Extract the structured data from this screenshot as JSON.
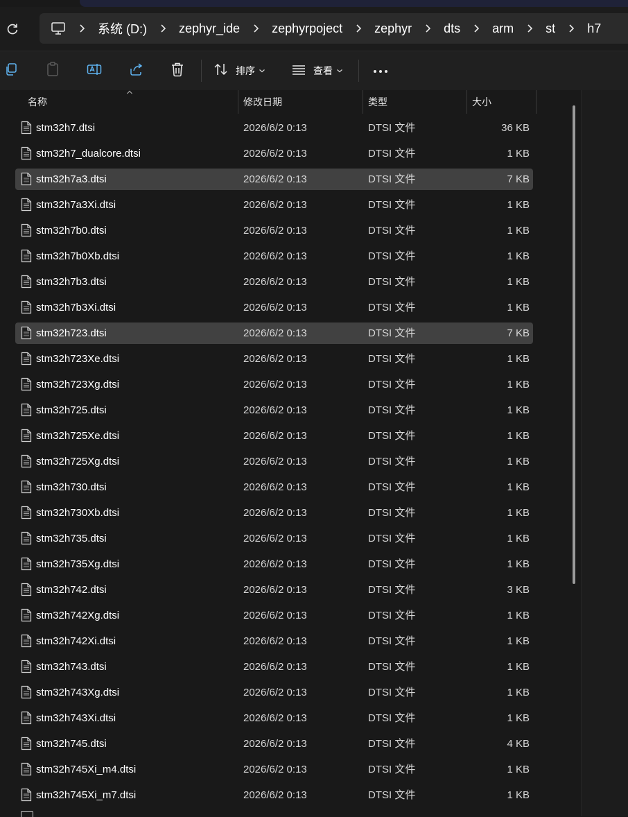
{
  "breadcrumb": [
    "系统 (D:)",
    "zephyr_ide",
    "zephyrpoject",
    "zephyr",
    "dts",
    "arm",
    "st",
    "h7"
  ],
  "toolbar": {
    "sort_label": "排序",
    "view_label": "查看"
  },
  "columns": {
    "name": "名称",
    "modified": "修改日期",
    "type": "类型",
    "size": "大小"
  },
  "files": [
    {
      "name": "stm32h7.dtsi",
      "modified": "2026/6/2 0:13",
      "type": "DTSI 文件",
      "size": "36 KB",
      "selected": false
    },
    {
      "name": "stm32h7_dualcore.dtsi",
      "modified": "2026/6/2 0:13",
      "type": "DTSI 文件",
      "size": "1 KB",
      "selected": false
    },
    {
      "name": "stm32h7a3.dtsi",
      "modified": "2026/6/2 0:13",
      "type": "DTSI 文件",
      "size": "7 KB",
      "selected": true
    },
    {
      "name": "stm32h7a3Xi.dtsi",
      "modified": "2026/6/2 0:13",
      "type": "DTSI 文件",
      "size": "1 KB",
      "selected": false
    },
    {
      "name": "stm32h7b0.dtsi",
      "modified": "2026/6/2 0:13",
      "type": "DTSI 文件",
      "size": "1 KB",
      "selected": false
    },
    {
      "name": "stm32h7b0Xb.dtsi",
      "modified": "2026/6/2 0:13",
      "type": "DTSI 文件",
      "size": "1 KB",
      "selected": false
    },
    {
      "name": "stm32h7b3.dtsi",
      "modified": "2026/6/2 0:13",
      "type": "DTSI 文件",
      "size": "1 KB",
      "selected": false
    },
    {
      "name": "stm32h7b3Xi.dtsi",
      "modified": "2026/6/2 0:13",
      "type": "DTSI 文件",
      "size": "1 KB",
      "selected": false
    },
    {
      "name": "stm32h723.dtsi",
      "modified": "2026/6/2 0:13",
      "type": "DTSI 文件",
      "size": "7 KB",
      "selected": true
    },
    {
      "name": "stm32h723Xe.dtsi",
      "modified": "2026/6/2 0:13",
      "type": "DTSI 文件",
      "size": "1 KB",
      "selected": false
    },
    {
      "name": "stm32h723Xg.dtsi",
      "modified": "2026/6/2 0:13",
      "type": "DTSI 文件",
      "size": "1 KB",
      "selected": false
    },
    {
      "name": "stm32h725.dtsi",
      "modified": "2026/6/2 0:13",
      "type": "DTSI 文件",
      "size": "1 KB",
      "selected": false
    },
    {
      "name": "stm32h725Xe.dtsi",
      "modified": "2026/6/2 0:13",
      "type": "DTSI 文件",
      "size": "1 KB",
      "selected": false
    },
    {
      "name": "stm32h725Xg.dtsi",
      "modified": "2026/6/2 0:13",
      "type": "DTSI 文件",
      "size": "1 KB",
      "selected": false
    },
    {
      "name": "stm32h730.dtsi",
      "modified": "2026/6/2 0:13",
      "type": "DTSI 文件",
      "size": "1 KB",
      "selected": false
    },
    {
      "name": "stm32h730Xb.dtsi",
      "modified": "2026/6/2 0:13",
      "type": "DTSI 文件",
      "size": "1 KB",
      "selected": false
    },
    {
      "name": "stm32h735.dtsi",
      "modified": "2026/6/2 0:13",
      "type": "DTSI 文件",
      "size": "1 KB",
      "selected": false
    },
    {
      "name": "stm32h735Xg.dtsi",
      "modified": "2026/6/2 0:13",
      "type": "DTSI 文件",
      "size": "1 KB",
      "selected": false
    },
    {
      "name": "stm32h742.dtsi",
      "modified": "2026/6/2 0:13",
      "type": "DTSI 文件",
      "size": "3 KB",
      "selected": false
    },
    {
      "name": "stm32h742Xg.dtsi",
      "modified": "2026/6/2 0:13",
      "type": "DTSI 文件",
      "size": "1 KB",
      "selected": false
    },
    {
      "name": "stm32h742Xi.dtsi",
      "modified": "2026/6/2 0:13",
      "type": "DTSI 文件",
      "size": "1 KB",
      "selected": false
    },
    {
      "name": "stm32h743.dtsi",
      "modified": "2026/6/2 0:13",
      "type": "DTSI 文件",
      "size": "1 KB",
      "selected": false
    },
    {
      "name": "stm32h743Xg.dtsi",
      "modified": "2026/6/2 0:13",
      "type": "DTSI 文件",
      "size": "1 KB",
      "selected": false
    },
    {
      "name": "stm32h743Xi.dtsi",
      "modified": "2026/6/2 0:13",
      "type": "DTSI 文件",
      "size": "1 KB",
      "selected": false
    },
    {
      "name": "stm32h745.dtsi",
      "modified": "2026/6/2 0:13",
      "type": "DTSI 文件",
      "size": "4 KB",
      "selected": false
    },
    {
      "name": "stm32h745Xi_m4.dtsi",
      "modified": "2026/6/2 0:13",
      "type": "DTSI 文件",
      "size": "1 KB",
      "selected": false
    },
    {
      "name": "stm32h745Xi_m7.dtsi",
      "modified": "2026/6/2 0:13",
      "type": "DTSI 文件",
      "size": "1 KB",
      "selected": false
    }
  ],
  "icons": {
    "refresh": "refresh-icon",
    "pc": "this-pc-icon",
    "copy": "copy-icon",
    "paste": "paste-icon",
    "rename": "rename-icon",
    "share": "share-icon",
    "delete": "delete-icon",
    "sort": "sort-icon",
    "view": "view-icon",
    "more": "more-icon",
    "file": "file-icon"
  },
  "colors": {
    "background": "#191919",
    "selected_row": "#414141",
    "address_box": "#2b2b2b"
  }
}
